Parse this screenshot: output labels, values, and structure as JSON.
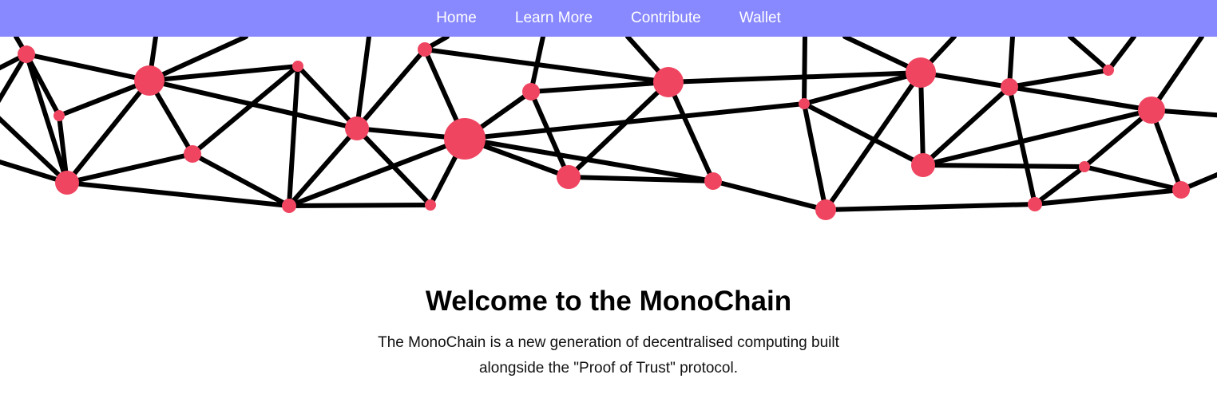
{
  "nav": {
    "links": [
      {
        "label": "Home"
      },
      {
        "label": "Learn More"
      },
      {
        "label": "Contribute"
      },
      {
        "label": "Wallet"
      }
    ]
  },
  "hero": {
    "title": "Welcome to the MonoChain",
    "description": "The MonoChain is a new generation of decentralised computing built alongside the \"Proof of Trust\" protocol."
  },
  "colors": {
    "nav_background": "#8888ff",
    "node_color": "#ef4560",
    "edge_color": "#000000"
  }
}
